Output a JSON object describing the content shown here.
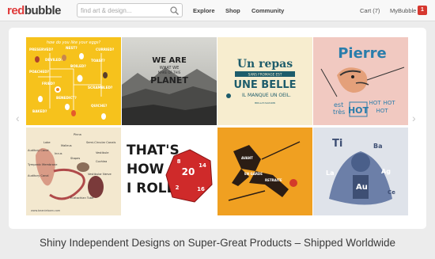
{
  "header": {
    "logo_part1": "red",
    "logo_part2": "bubble",
    "search_placeholder": "find art & design...",
    "nav": [
      "Explore",
      "Shop",
      "Community"
    ],
    "cart": "Cart (7)",
    "account": "MyBubble",
    "notifications": "1"
  },
  "gallery": {
    "prev_arrow": "‹",
    "next_arrow": "›",
    "tiles": [
      {
        "name": "egg-chart",
        "title": "how do you like your eggs?",
        "labels": [
          "PRESERVED?",
          "NEST?",
          "CURRIED?",
          "POACHED?",
          "DEVILED?",
          "TOAST?",
          "BOILED?",
          "FRIED?",
          "SCRAMBLED?",
          "BENEDICT?",
          "BAKED?",
          "QUICHE?"
        ]
      },
      {
        "name": "planet-text",
        "lines": [
          "WE ARE",
          "WHAT WE",
          "MAKE OF THIS",
          "PLANET"
        ]
      },
      {
        "name": "un-repas",
        "lines": [
          "Un repas",
          "SANS FROMAGE EST",
          "UNE BELLE",
          "IL MANQUE UN OEIL.",
          "BRILLAT-SAVARIN"
        ]
      },
      {
        "name": "pierre",
        "lines": [
          "Pierre",
          "est",
          "très",
          "HOT",
          "HOT",
          "HOT",
          "HOT"
        ]
      },
      {
        "name": "anatomy",
        "labels": [
          "Pinna",
          "Lobe",
          "Malleus",
          "Semi-Circular Canals",
          "Vestibule",
          "Auditory Canal",
          "Eustachian Tube",
          "Cochlea",
          "Vestibular Nerve",
          "Tympanic Membrane",
          "Stapes",
          "Incus",
          "Auditory Canal"
        ],
        "credit": "www.beanietown.com"
      },
      {
        "name": "roll-dice",
        "lines": [
          "THAT'S",
          "HOW",
          "I ROLL"
        ],
        "dice_numbers": [
          "20",
          "8",
          "14",
          "2",
          "16"
        ]
      },
      {
        "name": "duel",
        "labels": [
          "AVANT",
          "RETRAITE",
          "EN GARDE"
        ]
      },
      {
        "name": "periodic",
        "labels": [
          "Ti",
          "Ba",
          "La",
          "Ag",
          "Au",
          "Ce"
        ]
      }
    ]
  },
  "tagline": "Shiny Independent Designs on Super-Great Products – Shipped Worldwide",
  "colors": {
    "brand_red": "#e03a3a",
    "badge": "#d6382f"
  }
}
